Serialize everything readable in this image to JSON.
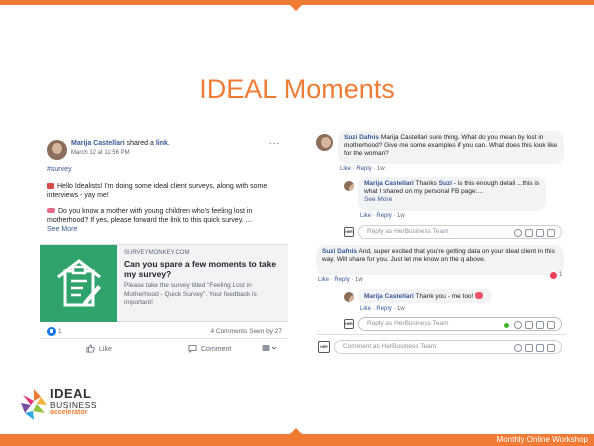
{
  "slide": {
    "title": "IDEAL Moments",
    "footer": "Monthly Online Workshop",
    "accent_color": "#ef7b34"
  },
  "post": {
    "author": "Marija Castellari",
    "action": " shared a ",
    "action_link": "link",
    "date": "March 12 at 11:56 PM",
    "menu": "···",
    "hashtag": "#survey",
    "paragraph1": "Hello Idealists! I'm doing some ideal client surveys, along with some interviews - yay me!",
    "paragraph2": "Do you know a mother with young children who's feeling lost in motherhood? If yes, please forward the link to this quick survey. ...",
    "see_more": "See More",
    "link": {
      "domain": "SURVEYMONKEY.COM",
      "title": "Can you spare a few moments to take my survey?",
      "description": "Please take the survey titled \"Feeling Lost in Motherhood - Quick Survey\". Your feedback is important!"
    },
    "reactions_count": "1",
    "stats_right": "4 Comments  Seen by 27",
    "actions": {
      "like": "Like",
      "comment": "Comment"
    }
  },
  "comments": [
    {
      "author": "Suzi Dafnis",
      "text": " Marija Castellari sure thing. What do you mean by lost in motherhood? Give me some examples if you can. What does this look like for the woman?",
      "meta_like": "Like",
      "meta_reply": "Reply",
      "meta_time": "1w"
    },
    {
      "author": "Marija Castellari",
      "text_before": " Thanks ",
      "mention": "Suzi",
      "text_after": " - is this enough detail ...this is what I shared on my personal FB page:...",
      "see_more": "See More",
      "meta_like": "Like",
      "meta_reply": "Reply",
      "meta_time": "1w"
    },
    {
      "author": "Suzi Dafnis",
      "text": " And, super excited that you're getting data on your ideal client in this way. Will share for you. Just let me know on the q above.",
      "reaction_count": "1",
      "meta_like": "Like",
      "meta_reply": "Reply",
      "meta_time": "1w"
    },
    {
      "author": "Marija Castellari",
      "text": " Thank you - me too!",
      "meta_like": "Like",
      "meta_reply": "Reply",
      "meta_time": "1w"
    }
  ],
  "reply_placeholder": "Reply as HerBusiness Team",
  "comment_placeholder": "Comment as HerBusiness Team",
  "team_avatar_text": "HER",
  "logo": {
    "line1": "IDEAL",
    "line2": "BUSINESS",
    "line3": "accelerator"
  }
}
